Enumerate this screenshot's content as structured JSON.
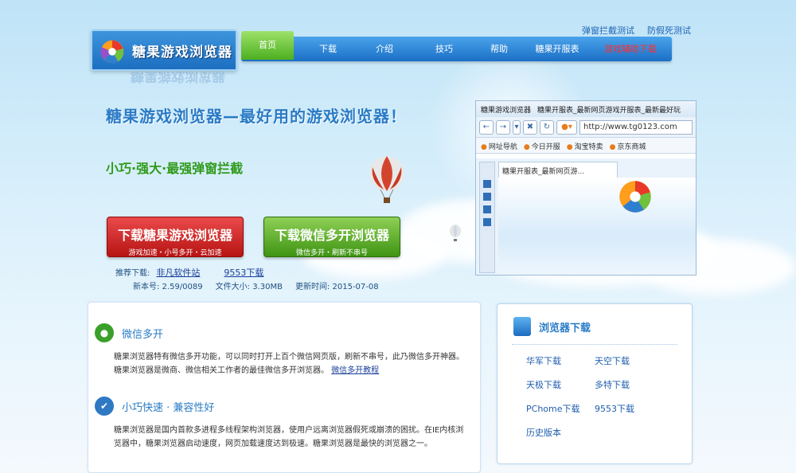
{
  "top_links": [
    "弹窗拦截测试",
    "防假死测试"
  ],
  "logo": {
    "text": "糖果游戏浏览器"
  },
  "nav": {
    "items": [
      {
        "label": "首页",
        "active": true
      },
      {
        "label": "下载"
      },
      {
        "label": "介绍"
      },
      {
        "label": "技巧"
      },
      {
        "label": "帮助"
      },
      {
        "label": "糖果开服表"
      },
      {
        "label": "游戏辅助下载",
        "color": "#ff2e2e"
      }
    ]
  },
  "hero": {
    "title": "糖果游戏浏览器—最好用的游戏浏览器！",
    "subtitle": "小巧·强大·最强弹窗拦截",
    "download_main": {
      "label": "下载糖果游戏浏览器",
      "sub": "游戏加速・小号多开・云加速"
    },
    "download_wechat": {
      "label": "下载微信多开浏览器",
      "sub": "微信多开・刷新不串号"
    },
    "recommend_label": "推荐下载:",
    "recommend_links": [
      "非凡软件站",
      "9553下载"
    ],
    "version": "新本号: 2.59/0089",
    "size": "文件大小: 3.30MB",
    "updated": "更新时间: 2015-07-08"
  },
  "browser_mock": {
    "title": "糖果游戏浏览器",
    "title_tab": "糖果开服表_最新网页游戏开服表_最新最好玩",
    "url": "http://www.tg0123.com",
    "favorites": [
      "网址导航",
      "今日开服",
      "淘宝特卖",
      "京东商城"
    ],
    "tab": "糖果开服表_最新网页游..."
  },
  "features": [
    {
      "title": "微信多开",
      "text": "糖果浏览器特有微信多开功能，可以同时打开上百个微信网页版，刷新不串号，此乃微信多开神器。糖果浏览器是微商、微信相关工作者的最佳微信多开浏览器。",
      "link": "微信多开教程",
      "icon_color": "#3aa02a"
    },
    {
      "title": "小巧快速 · 兼容性好",
      "text": "糖果浏览器是国内首款多进程多线程架构浏览器，使用户远离浏览器假死或崩溃的困扰。在IE内核浏览器中，糖果浏览器启动速度，网页加载速度达到极速。糖果浏览器是最快的浏览器之一。",
      "icon_color": "#2f78c4"
    }
  ],
  "side": {
    "title": "浏览器下载",
    "links": [
      "华军下载",
      "天空下载",
      "天极下载",
      "多特下载",
      "PChome下载",
      "9553下载",
      "历史版本"
    ]
  }
}
